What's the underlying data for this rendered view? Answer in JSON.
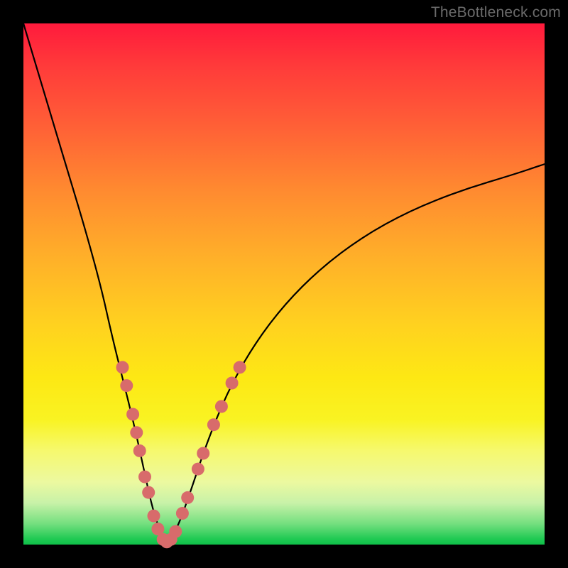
{
  "watermark": "TheBottleneck.com",
  "colors": {
    "frame": "#000000",
    "curve": "#000000",
    "dot": "#d86b6b",
    "gradient_top": "#ff1a3c",
    "gradient_bottom": "#0fbf49"
  },
  "chart_data": {
    "type": "line",
    "title": "",
    "xlabel": "",
    "ylabel": "",
    "xlim": [
      0,
      100
    ],
    "ylim": [
      0,
      100
    ],
    "note": "Axes are unlabeled; values are normalized 0–100 estimated from pixel positions. y=0 is bottom of plot.",
    "series": [
      {
        "name": "bottleneck-curve",
        "x": [
          0,
          3,
          6,
          9,
          12,
          15,
          17,
          19,
          21,
          23,
          24.5,
          26,
          27.5,
          29.5,
          32,
          35,
          39,
          44,
          50,
          57,
          65,
          74,
          84,
          94,
          100
        ],
        "y": [
          100,
          90,
          80,
          70,
          60,
          49,
          40,
          32,
          24,
          15,
          8,
          3,
          0.5,
          3,
          10,
          19,
          29,
          38,
          46,
          53,
          59,
          64,
          68,
          71,
          73
        ]
      }
    ],
    "scatter": {
      "name": "sample-points",
      "note": "Coral dots overlaid on the curve near the trough, same 0–100 coord space.",
      "points": [
        {
          "x": 19.0,
          "y": 34.0
        },
        {
          "x": 19.8,
          "y": 30.5
        },
        {
          "x": 21.0,
          "y": 25.0
        },
        {
          "x": 21.7,
          "y": 21.5
        },
        {
          "x": 22.3,
          "y": 18.0
        },
        {
          "x": 23.3,
          "y": 13.0
        },
        {
          "x": 24.0,
          "y": 10.0
        },
        {
          "x": 25.0,
          "y": 5.5
        },
        {
          "x": 25.8,
          "y": 3.0
        },
        {
          "x": 26.8,
          "y": 1.0
        },
        {
          "x": 27.5,
          "y": 0.5
        },
        {
          "x": 28.3,
          "y": 1.0
        },
        {
          "x": 29.2,
          "y": 2.5
        },
        {
          "x": 30.5,
          "y": 6.0
        },
        {
          "x": 31.5,
          "y": 9.0
        },
        {
          "x": 33.5,
          "y": 14.5
        },
        {
          "x": 34.5,
          "y": 17.5
        },
        {
          "x": 36.5,
          "y": 23.0
        },
        {
          "x": 38.0,
          "y": 26.5
        },
        {
          "x": 40.0,
          "y": 31.0
        },
        {
          "x": 41.5,
          "y": 34.0
        }
      ]
    }
  }
}
